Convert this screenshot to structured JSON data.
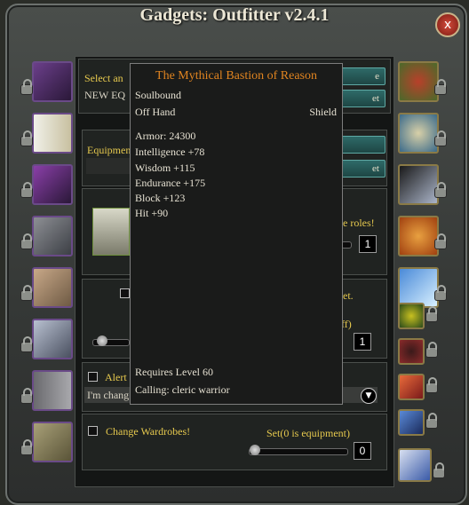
{
  "window": {
    "title": "Gadgets: Outfitter  v2.4.1",
    "close_label": "x"
  },
  "panel_top": {
    "select_label": "Select an",
    "set_value": "NEW EQ",
    "button1_label": "e",
    "button2_label": "et"
  },
  "panel_equipment": {
    "label": "Equipmen",
    "button_label": "et"
  },
  "roles_section": {
    "text_fragment": "e roles!",
    "slider_value": "1"
  },
  "set_section": {
    "text_fragment": "et.",
    "extra_fragment": "ff)",
    "slider_value": "1"
  },
  "alert_section": {
    "label": "Alert",
    "text": "I'm chang"
  },
  "wardrobe_section": {
    "label": "Change Wardrobes!",
    "set_label": "Set(0 is equipment)",
    "value": "0"
  },
  "tooltip": {
    "title": "The Mythical Bastion of Reason",
    "binding": "Soulbound",
    "slot": "Off Hand",
    "type": "Shield",
    "stats": [
      "Armor: 24300",
      "Intelligence +78",
      "Wisdom +115",
      "Endurance +175",
      "Block +123",
      "Hit +90"
    ],
    "requires": "Requires Level 60",
    "calling": "Calling: cleric warrior"
  }
}
